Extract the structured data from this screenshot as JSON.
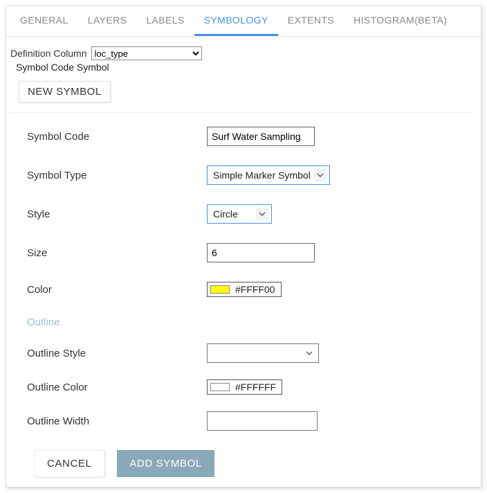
{
  "tabs": {
    "general": "GENERAL",
    "layers": "LAYERS",
    "labels": "LABELS",
    "symbology": "SYMBOLOGY",
    "extents": "EXTENTS",
    "histogram": "HISTOGRAM(BETA)"
  },
  "definition": {
    "label": "Definition Column",
    "value": "loc_type"
  },
  "subheader": "Symbol Code Symbol",
  "newSymbolButton": "NEW SYMBOL",
  "form": {
    "symbolCode": {
      "label": "Symbol Code",
      "value": "Surf Water Sampling"
    },
    "symbolType": {
      "label": "Symbol Type",
      "value": "Simple Marker Symbol"
    },
    "style": {
      "label": "Style",
      "value": "Circle"
    },
    "size": {
      "label": "Size",
      "value": "6"
    },
    "color": {
      "label": "Color",
      "swatch": "#FFFF00",
      "text": "#FFFF00"
    },
    "outlineSection": "Outline",
    "outlineStyle": {
      "label": "Outline Style",
      "value": ""
    },
    "outlineColor": {
      "label": "Outline Color",
      "swatch": "#FFFFFF",
      "text": "#FFFFFF"
    },
    "outlineWidth": {
      "label": "Outline Width",
      "value": ""
    }
  },
  "buttons": {
    "cancel": "CANCEL",
    "add": "ADD SYMBOL"
  }
}
